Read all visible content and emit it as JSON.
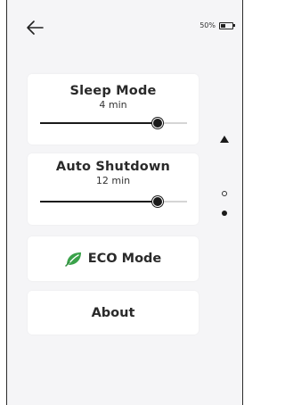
{
  "status": {
    "battery_text": "50%",
    "battery_level": 0.5
  },
  "cards": {
    "sleep": {
      "title": "Sleep Mode",
      "value_text": "4 min",
      "slider_fraction": 0.8
    },
    "shutdown": {
      "title": "Auto Shutdown",
      "value_text": "12 min",
      "slider_fraction": 0.8
    },
    "eco": {
      "label": "ECO Mode",
      "icon": "leaf-icon",
      "icon_color": "#3aa24a"
    },
    "about": {
      "label": "About"
    }
  },
  "pager": {
    "pages": 2,
    "current_page": 2
  },
  "colors": {
    "accent": "#1a1a1a",
    "background": "#f5f5f7",
    "card": "#ffffff",
    "leaf": "#3aa24a"
  }
}
